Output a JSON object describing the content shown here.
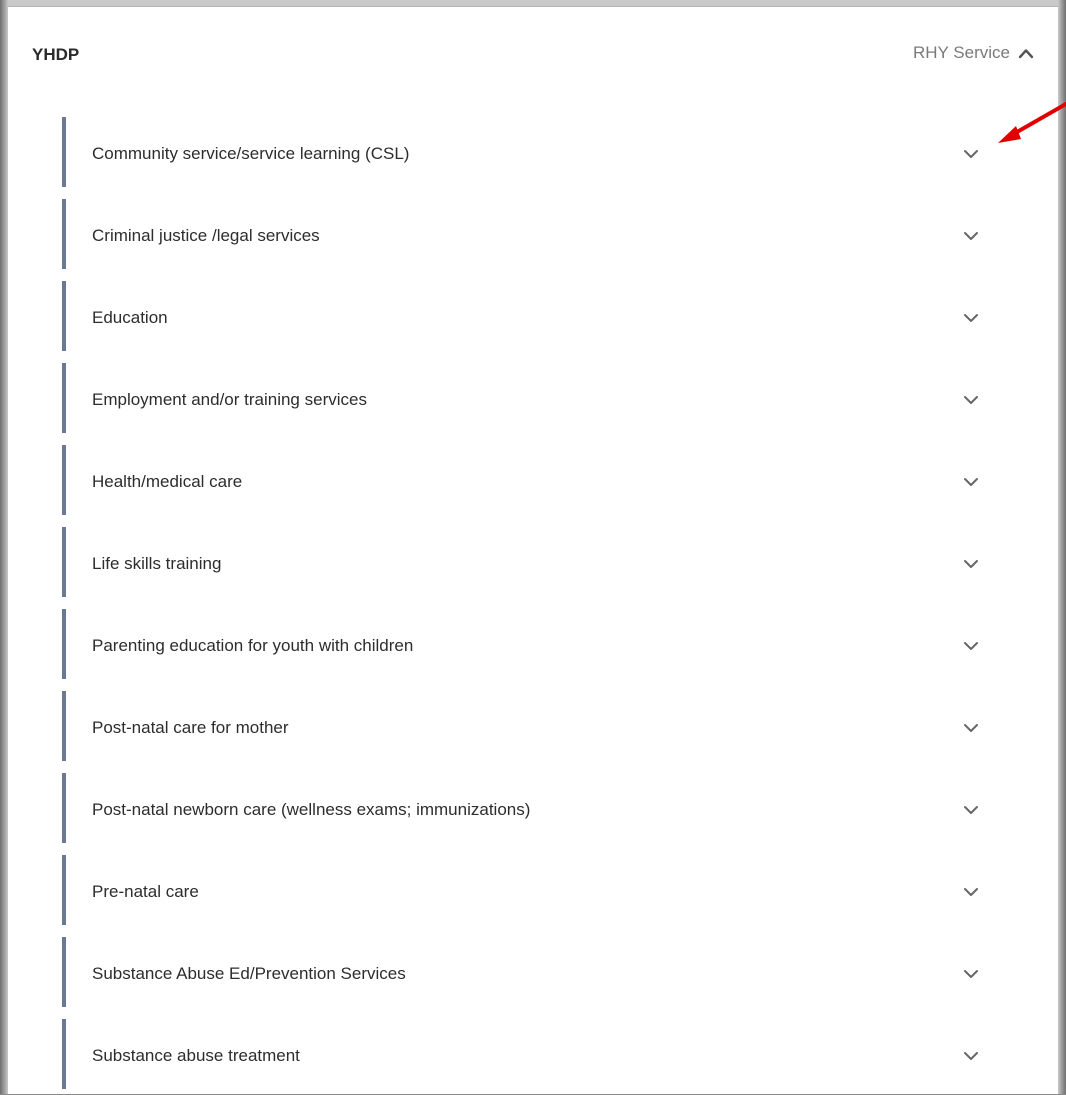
{
  "panel": {
    "title": "YHDP",
    "header_toggle_label": "RHY Service",
    "header_toggle_icon": "chevron-up-icon"
  },
  "services": [
    {
      "label": "Community service/service learning (CSL)",
      "icon": "chevron-down-icon"
    },
    {
      "label": "Criminal justice /legal services",
      "icon": "chevron-down-icon"
    },
    {
      "label": "Education",
      "icon": "chevron-down-icon"
    },
    {
      "label": "Employment and/or training services",
      "icon": "chevron-down-icon"
    },
    {
      "label": "Health/medical care",
      "icon": "chevron-down-icon"
    },
    {
      "label": "Life skills training",
      "icon": "chevron-down-icon"
    },
    {
      "label": "Parenting education for youth with children",
      "icon": "chevron-down-icon"
    },
    {
      "label": "Post-natal care for mother",
      "icon": "chevron-down-icon"
    },
    {
      "label": "Post-natal newborn care (wellness exams; immunizations)",
      "icon": "chevron-down-icon"
    },
    {
      "label": "Pre-natal care",
      "icon": "chevron-down-icon"
    },
    {
      "label": "Substance Abuse Ed/Prevention Services",
      "icon": "chevron-down-icon"
    },
    {
      "label": "Substance abuse treatment",
      "icon": "chevron-down-icon"
    }
  ],
  "annotation": {
    "icon": "arrow-pointer-icon",
    "color": "#e00000"
  },
  "colors": {
    "row_bar": "#6b7a90",
    "text": "#2d2d2d",
    "muted": "#7a7a7a"
  }
}
